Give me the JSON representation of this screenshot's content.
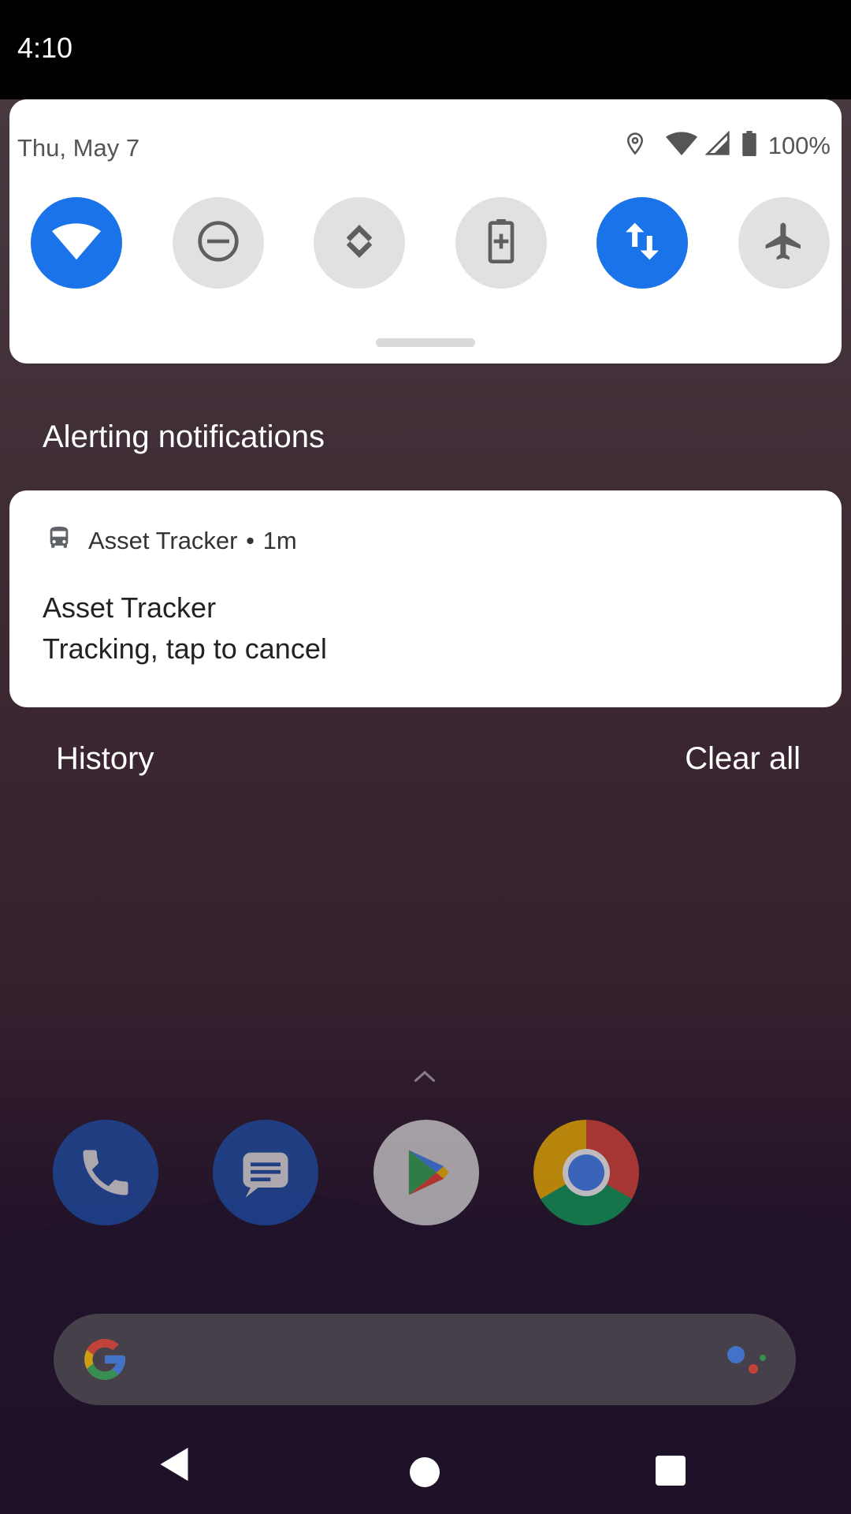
{
  "status_bar": {
    "time": "4:10"
  },
  "quick_settings": {
    "date": "Thu, May 7",
    "battery_percent": "100%",
    "tiles": [
      {
        "name": "wifi",
        "active": true
      },
      {
        "name": "do-not-disturb",
        "active": false
      },
      {
        "name": "auto-rotate",
        "active": false
      },
      {
        "name": "battery-saver",
        "active": false
      },
      {
        "name": "mobile-data",
        "active": true
      },
      {
        "name": "airplane-mode",
        "active": false
      }
    ]
  },
  "notifications": {
    "section_title": "Alerting notifications",
    "items": [
      {
        "app_name": "Asset Tracker",
        "separator": "•",
        "time_ago": "1m",
        "title": "Asset Tracker",
        "text": "Tracking, tap to cancel",
        "icon": "bus-icon"
      }
    ],
    "history_label": "History",
    "clear_all_label": "Clear all"
  },
  "home": {
    "dock_apps": [
      "Phone",
      "Messages",
      "Play Store",
      "Chrome"
    ]
  },
  "colors": {
    "accent": "#1a73e8",
    "tile_off": "#e1e1e1"
  }
}
